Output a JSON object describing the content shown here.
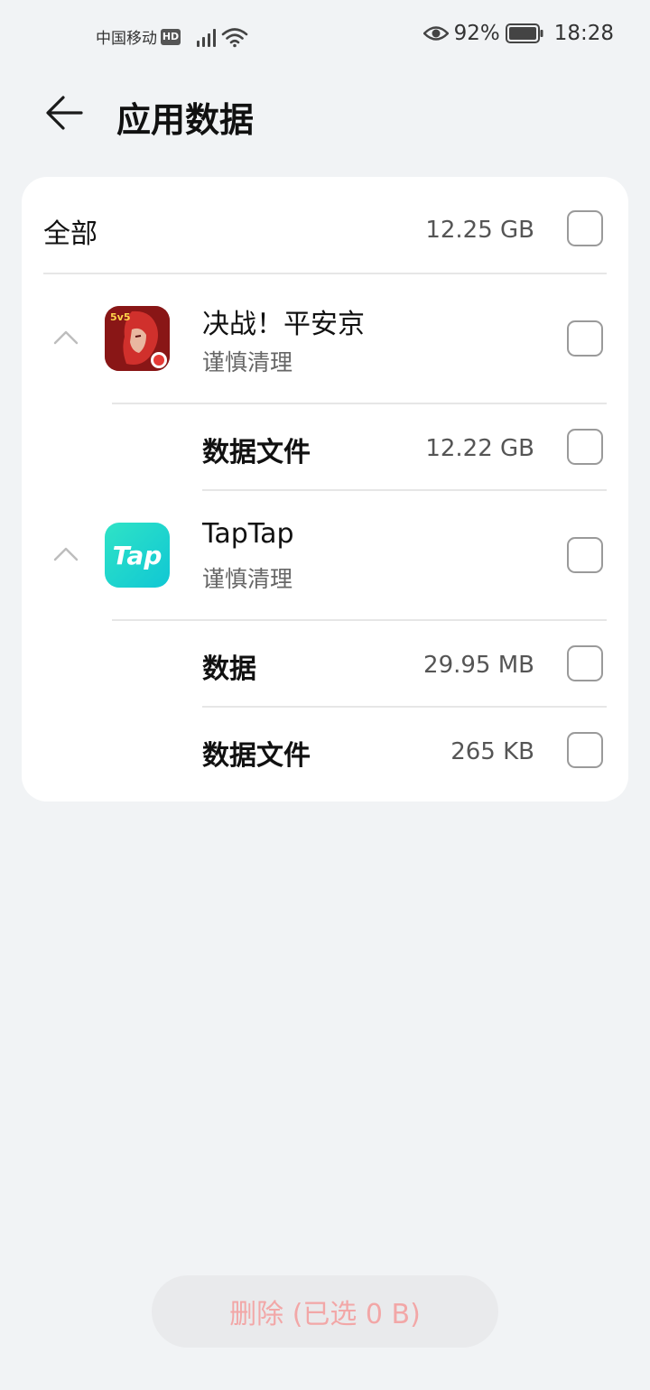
{
  "status_bar": {
    "carrier": "中国移动",
    "hd_badge": "HD",
    "battery_percent": "92%",
    "time": "18:28"
  },
  "header": {
    "title": "应用数据"
  },
  "all_row": {
    "label": "全部",
    "size": "12.25 GB"
  },
  "apps": [
    {
      "name": "决战！平安京",
      "subtitle": "谨慎清理",
      "icon": "game-app-icon",
      "items": [
        {
          "label": "数据文件",
          "size": "12.22 GB"
        }
      ]
    },
    {
      "name": "TapTap",
      "subtitle": "谨慎清理",
      "icon": "taptap-app-icon",
      "icon_text": "Tap",
      "items": [
        {
          "label": "数据",
          "size": "29.95 MB"
        },
        {
          "label": "数据文件",
          "size": "265 KB"
        }
      ]
    }
  ],
  "delete_button": {
    "label": "删除 (已选 0 B)"
  },
  "colors": {
    "background": "#f1f3f5",
    "card": "#ffffff",
    "delete_text": "#f2a7a7",
    "taptap_brand": "#16d6c7"
  }
}
